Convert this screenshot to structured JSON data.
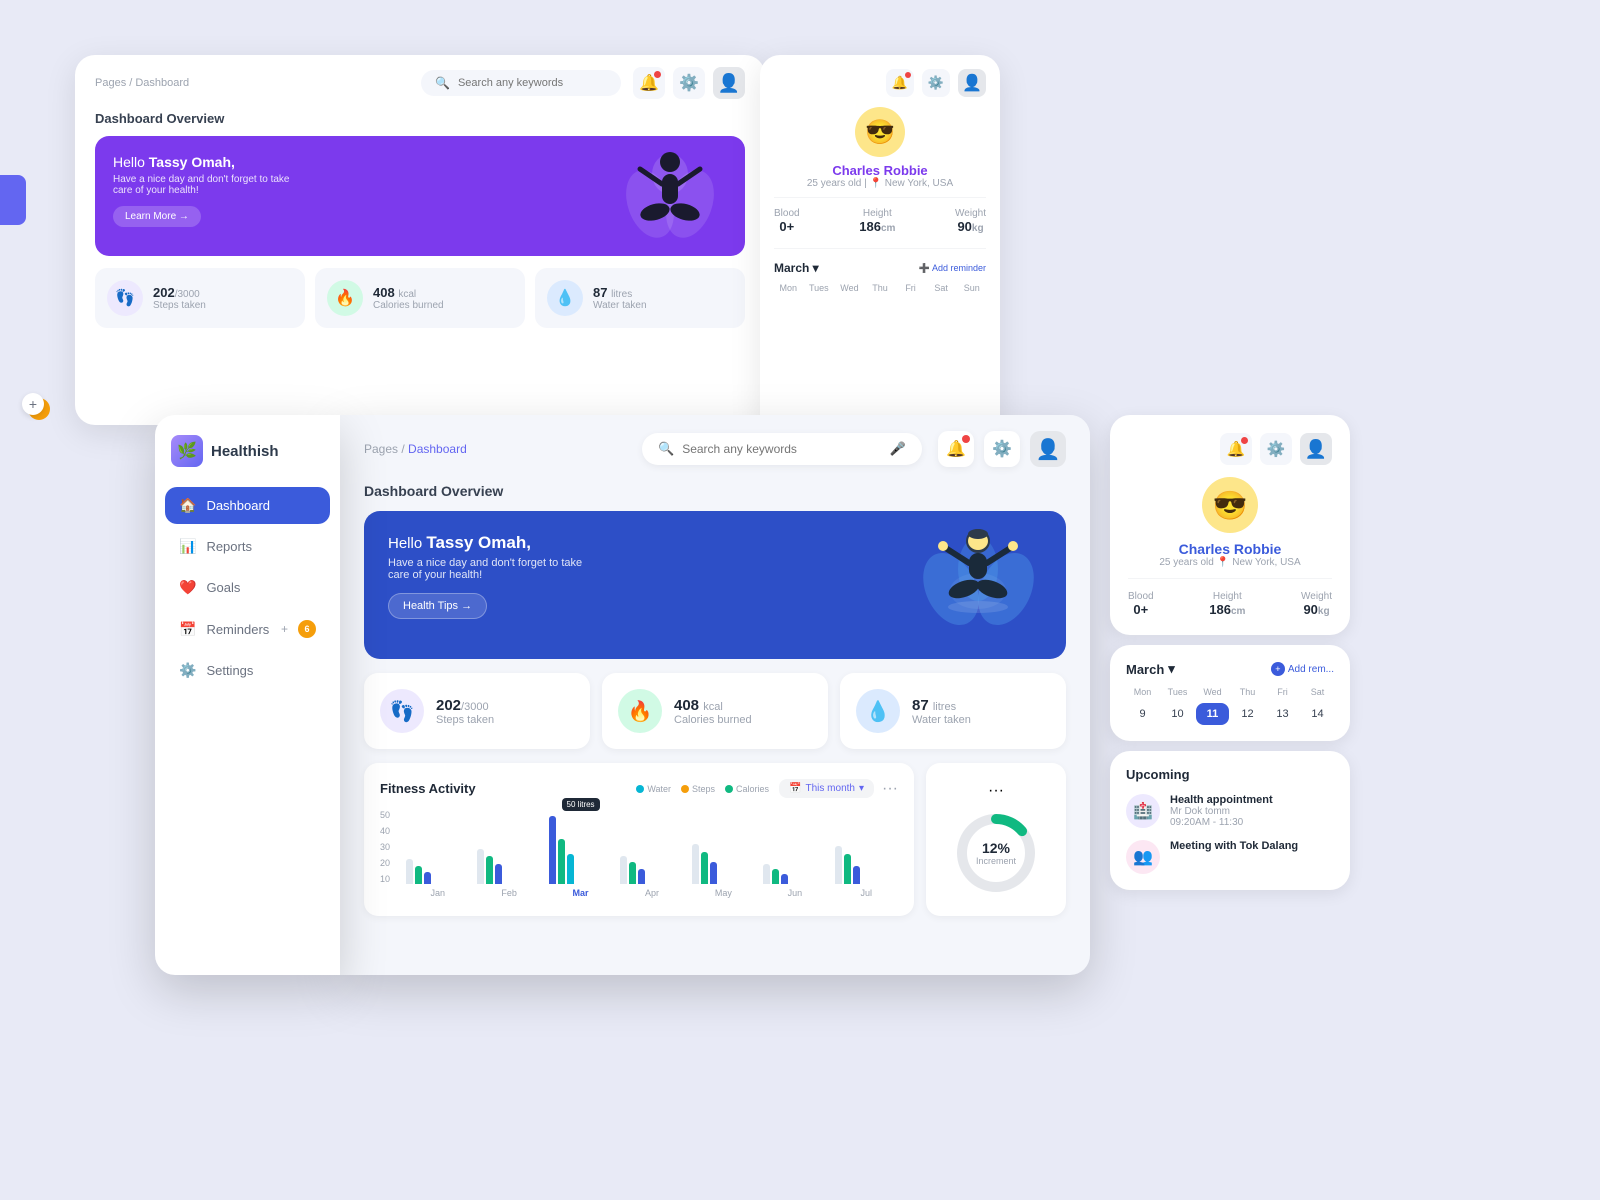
{
  "app": {
    "name": "Healthish",
    "logo_icon": "🌿"
  },
  "back_layer": {
    "breadcrumb": "Pages / Dashboard",
    "search_placeholder": "Search any keywords",
    "hero": {
      "greeting": "Hello ",
      "user": "Tassy Omah,",
      "subtitle": "Have a nice day and don't forget to take care of your health!",
      "cta": "Learn More →"
    },
    "overview_title": "Dashboard Overview",
    "stats": [
      {
        "icon": "👣",
        "value": "202",
        "total": "3000",
        "unit": "",
        "label": "Steps taken"
      },
      {
        "icon": "🔥",
        "value": "408",
        "unit": "kcal",
        "label": "Calories burned"
      },
      {
        "icon": "💧",
        "value": "87",
        "unit": "litres",
        "label": "Water taken"
      }
    ]
  },
  "sidebar": {
    "logo_text": "Healthish",
    "items": [
      {
        "icon": "🏠",
        "label": "Dashboard",
        "active": true
      },
      {
        "icon": "📊",
        "label": "Reports",
        "active": false
      },
      {
        "icon": "❤️",
        "label": "Goals",
        "active": false
      },
      {
        "icon": "📅",
        "label": "Reminders",
        "active": false,
        "has_plus": true,
        "badge": "6"
      },
      {
        "icon": "⚙️",
        "label": "Settings",
        "active": false
      }
    ]
  },
  "main": {
    "breadcrumb_pages": "Pages",
    "breadcrumb_current": "Dashboard",
    "search_placeholder": "Search any keywords",
    "overview_title": "Dashboard Overview",
    "hero": {
      "greeting": "Hello ",
      "user": "Tassy Omah,",
      "subtitle": "Have a nice day and don't forget to take care of your health!",
      "cta": "Health Tips →"
    },
    "stats": [
      {
        "icon": "👣",
        "color_class": "steps",
        "value": "202",
        "total": "/3000",
        "label": "Steps taken"
      },
      {
        "icon": "🔥",
        "color_class": "calories",
        "value": "408",
        "unit": " kcal",
        "label": "Calories burned"
      },
      {
        "icon": "💧",
        "color_class": "water",
        "value": "87",
        "unit": " litres",
        "label": "Water taken"
      }
    ],
    "fitness": {
      "title": "Fitness Activity",
      "legend": [
        {
          "label": "Water",
          "color": "#06b6d4"
        },
        {
          "label": "Steps",
          "color": "#f59e0b"
        },
        {
          "label": "Calories",
          "color": "#10b981"
        }
      ],
      "filter": "This month",
      "y_labels": [
        "50",
        "40",
        "30",
        "20",
        "10"
      ],
      "x_labels": [
        "Jan",
        "Feb",
        "Mar",
        "Apr",
        "May"
      ]
    }
  },
  "profile": {
    "name": "Charles Robbie",
    "age": "25 years old",
    "location": "New York, USA",
    "stats": [
      {
        "label": "Blood",
        "value": "0+",
        "unit": ""
      },
      {
        "label": "Height",
        "value": "186",
        "unit": "cm"
      },
      {
        "label": "Weight",
        "value": "90",
        "unit": "kg"
      }
    ]
  },
  "calendar": {
    "month": "March",
    "days_header": [
      "Mon",
      "Tues",
      "Wed",
      "Thu",
      "Fri",
      "Sat"
    ],
    "days": [
      {
        "num": "9",
        "today": false
      },
      {
        "num": "10",
        "today": false
      },
      {
        "num": "11",
        "today": true
      },
      {
        "num": "12",
        "today": false
      },
      {
        "num": "13",
        "today": false
      },
      {
        "num": "14",
        "today": false
      }
    ],
    "add_reminder": "Add rem..."
  },
  "upcoming": {
    "title": "Upcoming",
    "appointments": [
      {
        "icon": "🏥",
        "name": "Health appointment",
        "person": "Mr Dok tomm",
        "time": "09:20AM - 11:30"
      },
      {
        "icon": "👤",
        "name": "Meeting with Tok Dalang",
        "person": "",
        "time": ""
      }
    ]
  },
  "donut": {
    "percent": "12%",
    "label": "Increment"
  },
  "colors": {
    "primary": "#3b5bdb",
    "purple_hero": "#7c3aed",
    "blue_hero": "#2d4fc7",
    "accent": "#f59e0b",
    "bg": "#e8eaf6"
  }
}
